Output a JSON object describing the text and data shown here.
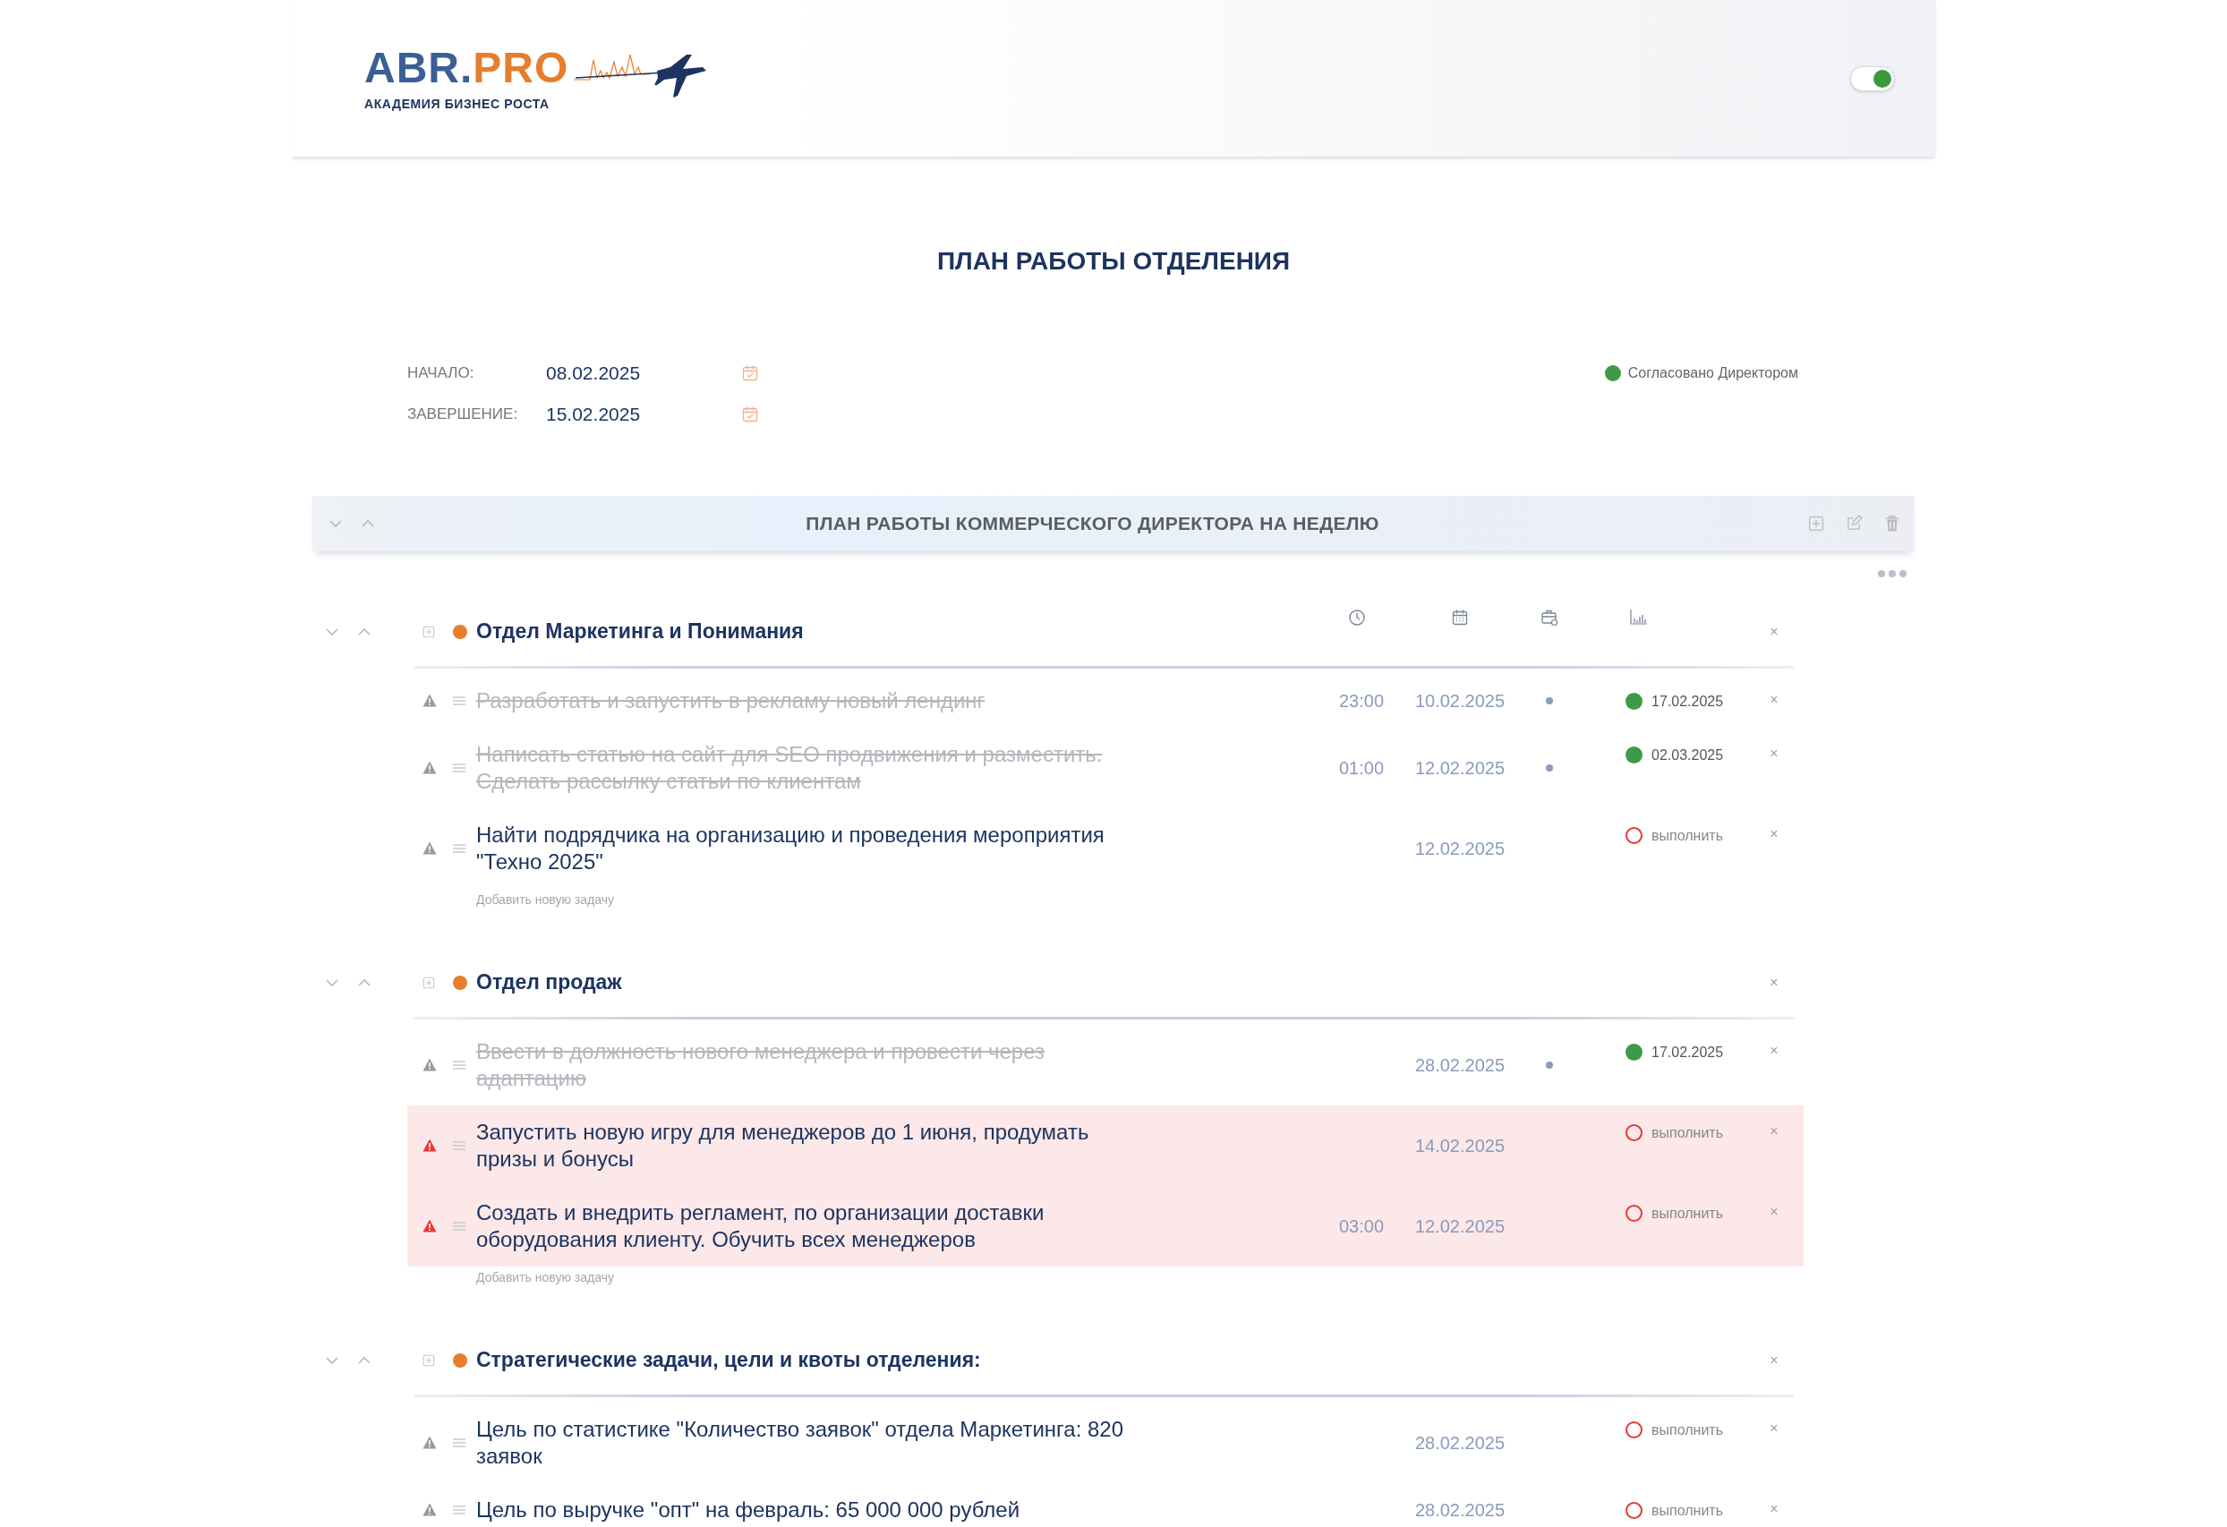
{
  "header": {
    "logo": {
      "brand": "ABR.",
      "brand_accent": "PRO",
      "tagline": "АКАДЕМИЯ БИЗНЕС РОСТА"
    },
    "theme_toggle": {
      "on": true
    }
  },
  "page_title": "ПЛАН РАБОТЫ ОТДЕЛЕНИЯ",
  "period": [
    {
      "label": "НАЧАЛО:",
      "value": "08.02.2025"
    },
    {
      "label": "ЗАВЕРШЕНИЕ:",
      "value": "15.02.2025"
    }
  ],
  "approval": {
    "approved": true,
    "label": "Согласовано Директором"
  },
  "plan": {
    "title": "ПЛАН РАБОТЫ КОММЕРЧЕСКОГО ДИРЕКТОРА НА НЕДЕЛЮ"
  },
  "sections": [
    {
      "title": "Отдел Маркетинга и Понимания",
      "column_icons": true,
      "close": "×",
      "add_task": "Добавить новую задачу",
      "tasks": [
        {
          "text": "Разработать и запустить в рекламу новый лендинг",
          "done": true,
          "urgent": false,
          "time": "23:00",
          "date": "10.02.2025",
          "status": {
            "kind": "done",
            "date": "17.02.2025"
          },
          "close": "×"
        },
        {
          "text": "Написать статью на сайт для SEO продвижения и разместить. Сделать рассылку статьи по клиентам",
          "done": true,
          "urgent": false,
          "time": "01:00",
          "date": "12.02.2025",
          "status": {
            "kind": "done",
            "date": "02.03.2025"
          },
          "close": "×"
        },
        {
          "text": "Найти подрядчика на организацию и проведения мероприятия \"Техно 2025\"",
          "done": false,
          "urgent": false,
          "date": "12.02.2025",
          "status": {
            "kind": "todo",
            "label": "выполнить"
          },
          "close": "×"
        }
      ]
    },
    {
      "title": "Отдел продаж",
      "column_icons": false,
      "close": "×",
      "add_task": "Добавить новую задачу",
      "tasks": [
        {
          "text": "Ввести в должность нового менеджера и провести через адаптацию",
          "done": true,
          "urgent": false,
          "date": "28.02.2025",
          "status": {
            "kind": "done",
            "date": "17.02.2025"
          },
          "close": "×"
        },
        {
          "text": "Запустить новую игру для менеджеров до 1 июня, продумать призы и бонусы",
          "done": false,
          "urgent": true,
          "date": "14.02.2025",
          "status": {
            "kind": "todo",
            "label": "выполнить"
          },
          "close": "×"
        },
        {
          "text": "Создать и внедрить регламент, по организации доставки оборудования клиенту. Обучить всех менеджеров",
          "done": false,
          "urgent": true,
          "time": "03:00",
          "date": "12.02.2025",
          "status": {
            "kind": "todo",
            "label": "выполнить"
          },
          "close": "×"
        }
      ]
    },
    {
      "title": "Стратегические задачи, цели и квоты отделения:",
      "column_icons": false,
      "close": "×",
      "tasks": [
        {
          "text": "Цель по статистике \"Количество заявок\" отдела Маркетинга: 820 заявок",
          "done": false,
          "urgent": false,
          "date": "28.02.2025",
          "status": {
            "kind": "todo",
            "label": "выполнить"
          },
          "close": "×"
        },
        {
          "text": "Цель по выручке \"опт\" на февраль: 65 000 000 рублей",
          "done": false,
          "urgent": false,
          "date": "28.02.2025",
          "status": {
            "kind": "todo",
            "label": "выполнить"
          },
          "close": "×"
        }
      ]
    }
  ]
}
